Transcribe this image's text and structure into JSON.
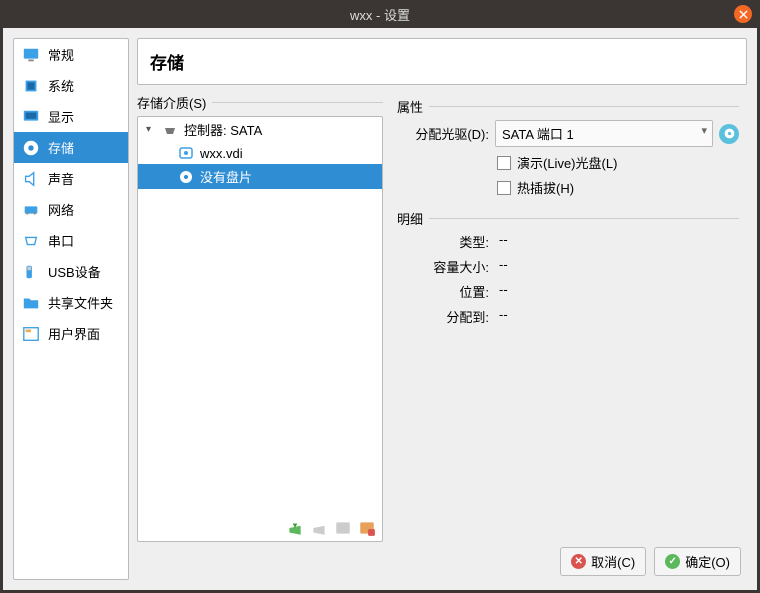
{
  "window": {
    "title": "wxx - 设置"
  },
  "sidebar": {
    "items": [
      {
        "label": "常规"
      },
      {
        "label": "系统"
      },
      {
        "label": "显示"
      },
      {
        "label": "存储"
      },
      {
        "label": "声音"
      },
      {
        "label": "网络"
      },
      {
        "label": "串口"
      },
      {
        "label": "USB设备"
      },
      {
        "label": "共享文件夹"
      },
      {
        "label": "用户界面"
      }
    ],
    "active_index": 3
  },
  "page": {
    "title": "存储"
  },
  "storage": {
    "media_label": "存储介质(S)",
    "controller_label": "控制器: SATA",
    "items": [
      {
        "label": "wxx.vdi"
      },
      {
        "label": "没有盘片"
      }
    ],
    "selected_index": 1
  },
  "attributes": {
    "group_label": "属性",
    "drive_label": "分配光驱(D):",
    "drive_value": "SATA 端口 1",
    "live_cd_label": "演示(Live)光盘(L)",
    "live_cd_checked": false,
    "hotplug_label": "热插拔(H)",
    "hotplug_checked": false
  },
  "details": {
    "group_label": "明细",
    "rows": [
      {
        "label": "类型:",
        "value": "--"
      },
      {
        "label": "容量大小:",
        "value": "--"
      },
      {
        "label": "位置:",
        "value": "--"
      },
      {
        "label": "分配到:",
        "value": "--"
      }
    ]
  },
  "footer": {
    "cancel": "取消(C)",
    "ok": "确定(O)"
  }
}
